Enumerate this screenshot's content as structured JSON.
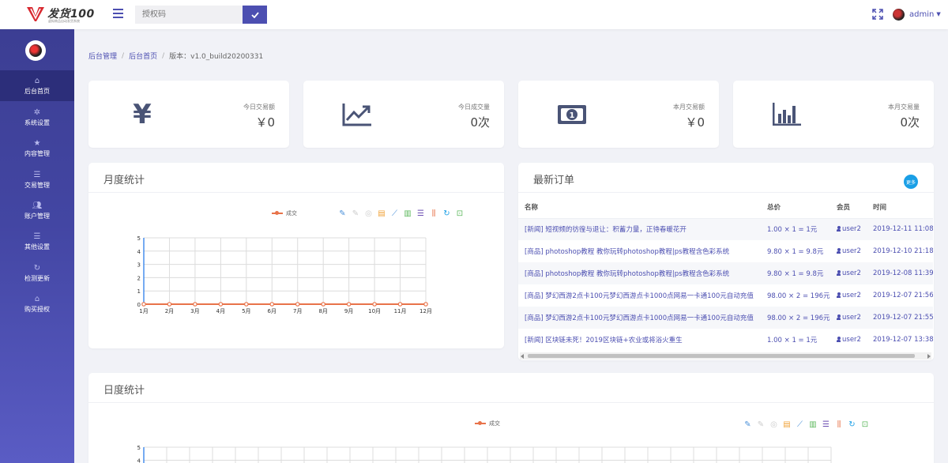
{
  "header": {
    "logo_text": "发货100",
    "logo_subtitle": "虚拟商品自动发货系统",
    "search": {
      "placeholder": "授权码"
    },
    "user": {
      "name": "admin"
    }
  },
  "sidebar": {
    "items": [
      {
        "label": "后台首页",
        "icon": "home-icon",
        "active": true
      },
      {
        "label": "系统设置",
        "icon": "gear-icon"
      },
      {
        "label": "内容管理",
        "icon": "star-icon"
      },
      {
        "label": "交易管理",
        "icon": "list-icon"
      },
      {
        "label": "账户管理",
        "icon": "users-icon"
      },
      {
        "label": "其他设置",
        "icon": "list-icon"
      },
      {
        "label": "检测更新",
        "icon": "refresh-icon"
      },
      {
        "label": "购买授权",
        "icon": "home-icon"
      }
    ]
  },
  "breadcrumb": {
    "items": [
      "后台管理",
      "后台首页"
    ],
    "version": "版本：v1.0_build20200331"
  },
  "stats": [
    {
      "label": "今日交易额",
      "value": "￥0",
      "icon": "yen-icon"
    },
    {
      "label": "今日成交量",
      "value": "0次",
      "icon": "trend-chart-icon"
    },
    {
      "label": "本月交易额",
      "value": "￥0",
      "icon": "money-icon"
    },
    {
      "label": "本月交易量",
      "value": "0次",
      "icon": "bar-chart-icon"
    }
  ],
  "monthly_panel": {
    "title": "月度统计",
    "legend": "成交"
  },
  "daily_panel": {
    "title": "日度统计",
    "legend": "成交"
  },
  "orders_panel": {
    "title": "最新订单",
    "more_label": "更多",
    "columns": [
      "名称",
      "总价",
      "会员",
      "时间"
    ],
    "rows": [
      {
        "name": "[新闻] 短视频的彷徨与退让：积蓄力量，正待春暖花开",
        "price": "1.00 × 1 = 1元",
        "user": "user2",
        "time": "2019-12-11 11:08"
      },
      {
        "name": "[商品] photoshop教程 教你玩转photoshop教程|ps教程含色彩系统",
        "price": "9.80 × 1 = 9.8元",
        "user": "user2",
        "time": "2019-12-10 21:18"
      },
      {
        "name": "[商品] photoshop教程 教你玩转photoshop教程|ps教程含色彩系统",
        "price": "9.80 × 1 = 9.8元",
        "user": "user2",
        "time": "2019-12-08 11:39"
      },
      {
        "name": "[商品] 梦幻西游2点卡100元梦幻西游点卡1000点网易一卡通100元自动充值",
        "price": "98.00 × 2 = 196元",
        "user": "user2",
        "time": "2019-12-07 21:56"
      },
      {
        "name": "[商品] 梦幻西游2点卡100元梦幻西游点卡1000点网易一卡通100元自动充值",
        "price": "98.00 × 2 = 196元",
        "user": "user2",
        "time": "2019-12-07 21:55"
      },
      {
        "name": "[新闻] 区块链未死！2019区块链+农业或将浴火重生",
        "price": "1.00 × 1 = 1元",
        "user": "user2",
        "time": "2019-12-07 13:38"
      }
    ]
  },
  "colors": {
    "accent": "#4c4fb1",
    "series": "#e8734a",
    "axis": "#1a73e8",
    "more": "#1a9fe6"
  },
  "chart_data": [
    {
      "type": "line",
      "title": "月度统计",
      "series": [
        {
          "name": "成交",
          "values": [
            0,
            0,
            0,
            0,
            0,
            0,
            0,
            0,
            0,
            0,
            0,
            0
          ]
        }
      ],
      "categories": [
        "1月",
        "2月",
        "3月",
        "4月",
        "5月",
        "6月",
        "7月",
        "8月",
        "9月",
        "10月",
        "11月",
        "12月"
      ],
      "yticks": [
        "0",
        "1",
        "2",
        "3",
        "4",
        "5"
      ],
      "ylim": [
        0,
        5
      ],
      "grid": true,
      "legend": "top-center"
    },
    {
      "type": "line",
      "title": "日度统计",
      "series": [
        {
          "name": "成交",
          "values": []
        }
      ],
      "categories": [],
      "yticks": [
        "4",
        "5"
      ],
      "ylim": [
        0,
        5
      ],
      "grid": true,
      "legend": "top-center"
    }
  ]
}
